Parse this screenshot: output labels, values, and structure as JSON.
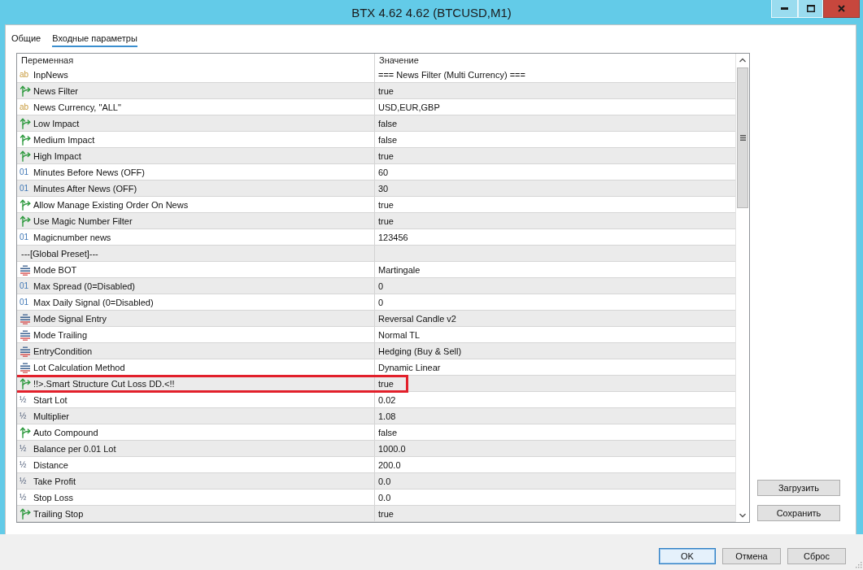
{
  "window": {
    "title": "BTX 4.62 4.62 (BTCUSD,M1)"
  },
  "tabs": [
    {
      "label": "Общие",
      "selected": false
    },
    {
      "label": "Входные параметры",
      "selected": true
    }
  ],
  "table": {
    "columns": [
      "Переменная",
      "Значение"
    ],
    "rows": [
      {
        "kind": "string",
        "glyph": "ab",
        "name": "InpNews",
        "value": "=== News Filter (Multi Currency) ===",
        "highlighted": false
      },
      {
        "kind": "bool",
        "name": "News Filter",
        "value": "true",
        "highlighted": false
      },
      {
        "kind": "string",
        "glyph": "ab",
        "name": "News Currency, \"ALL\"",
        "value": "USD,EUR,GBP",
        "highlighted": false
      },
      {
        "kind": "bool",
        "name": "Low Impact",
        "value": "false",
        "highlighted": false
      },
      {
        "kind": "bool",
        "name": "Medium Impact",
        "value": "false",
        "highlighted": false
      },
      {
        "kind": "bool",
        "name": "High Impact",
        "value": "true",
        "highlighted": false
      },
      {
        "kind": "int",
        "glyph": "01",
        "name": "Minutes Before News (OFF)",
        "value": "60",
        "highlighted": false
      },
      {
        "kind": "int",
        "glyph": "01",
        "name": "Minutes After News (OFF)",
        "value": "30",
        "highlighted": false
      },
      {
        "kind": "bool",
        "name": "Allow Manage Existing Order On News",
        "value": "true",
        "highlighted": false
      },
      {
        "kind": "bool",
        "name": "Use Magic Number Filter",
        "value": "true",
        "highlighted": false
      },
      {
        "kind": "int",
        "glyph": "01",
        "name": "Magicnumber news",
        "value": "123456",
        "highlighted": false
      },
      {
        "kind": "separator",
        "name": "---[Global Preset]---",
        "highlighted": false
      },
      {
        "kind": "enum",
        "name": "Mode BOT",
        "value": "Martingale",
        "highlighted": false
      },
      {
        "kind": "int",
        "glyph": "01",
        "name": "Max Spread (0=Disabled)",
        "value": "0",
        "highlighted": false
      },
      {
        "kind": "int",
        "glyph": "01",
        "name": "Max Daily Signal (0=Disabled)",
        "value": "0",
        "highlighted": false
      },
      {
        "kind": "enum",
        "name": "Mode Signal Entry",
        "value": "Reversal Candle v2",
        "highlighted": false
      },
      {
        "kind": "enum",
        "name": "Mode Trailing",
        "value": "Normal TL",
        "highlighted": false
      },
      {
        "kind": "enum",
        "name": "EntryCondition",
        "value": "Hedging (Buy & Sell)",
        "highlighted": false
      },
      {
        "kind": "enum",
        "name": "Lot Calculation Method",
        "value": "Dynamic Linear",
        "highlighted": false
      },
      {
        "kind": "bool",
        "name": "!!>.Smart Structure Cut Loss DD.<!!",
        "value": "true",
        "highlighted": true
      },
      {
        "kind": "double",
        "glyph": "½",
        "name": "Start Lot",
        "value": "0.02",
        "highlighted": false
      },
      {
        "kind": "double",
        "glyph": "½",
        "name": "Multiplier",
        "value": "1.08",
        "highlighted": false
      },
      {
        "kind": "bool",
        "name": "Auto Compound",
        "value": "false",
        "highlighted": false
      },
      {
        "kind": "double",
        "glyph": "½",
        "name": "Balance per 0.01 Lot",
        "value": "1000.0",
        "highlighted": false
      },
      {
        "kind": "double",
        "glyph": "½",
        "name": "Distance",
        "value": "200.0",
        "highlighted": false
      },
      {
        "kind": "double",
        "glyph": "½",
        "name": "Take Profit",
        "value": "0.0",
        "highlighted": false
      },
      {
        "kind": "double",
        "glyph": "½",
        "name": "Stop Loss",
        "value": "0.0",
        "highlighted": false
      },
      {
        "kind": "bool",
        "name": "Trailing Stop",
        "value": "true",
        "highlighted": false
      }
    ]
  },
  "side_buttons": [
    "Загрузить",
    "Сохранить"
  ],
  "buttons": [
    {
      "label": "OK",
      "default": true
    },
    {
      "label": "Отмена",
      "default": false
    },
    {
      "label": "Сброс",
      "default": false
    }
  ]
}
